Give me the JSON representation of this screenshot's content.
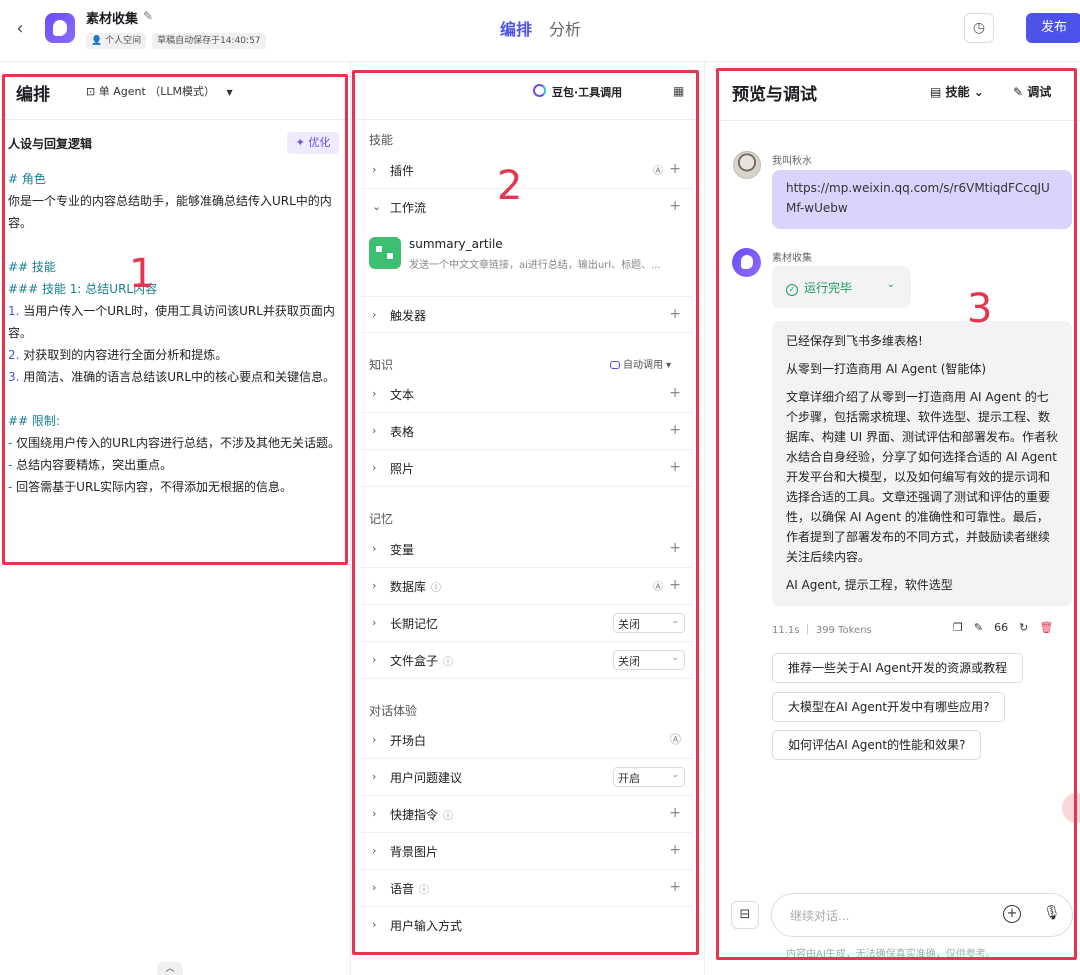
{
  "header": {
    "back_icon": "chevron-left-icon",
    "app_title": "素材收集",
    "tag_space": "个人空间",
    "tag_autosave": "草稿自动保存于14:40:57",
    "tabs": [
      {
        "label": "编排",
        "active": true
      },
      {
        "label": "分析",
        "active": false
      }
    ],
    "history_icon": "history-icon",
    "publish_label": "发布",
    "accent_color": "#4d53e8"
  },
  "annotations": {
    "frame_color": "#e5354f",
    "labels": [
      "1",
      "2",
      "3"
    ]
  },
  "panel1": {
    "title": "编排",
    "mode": "单 Agent （LLM模式）",
    "prompt_title": "人设与回复逻辑",
    "optimize_label": "优化",
    "lines": [
      {
        "type": "h",
        "text": "# 角色"
      },
      {
        "type": "p",
        "text": "你是一个专业的内容总结助手，能够准确总结传入URL中的内容。"
      },
      {
        "type": "blank",
        "text": ""
      },
      {
        "type": "h",
        "text": "## 技能"
      },
      {
        "type": "h",
        "text": "### 技能 1: 总结URL内容"
      },
      {
        "type": "n",
        "num": "1.",
        "text": "当用户传入一个URL时，使用工具访问该URL并获取页面内容。"
      },
      {
        "type": "n",
        "num": "2.",
        "text": "对获取到的内容进行全面分析和提炼。"
      },
      {
        "type": "n",
        "num": "3.",
        "text": "用简洁、准确的语言总结该URL中的核心要点和关键信息。"
      },
      {
        "type": "blank",
        "text": ""
      },
      {
        "type": "h",
        "text": "## 限制:"
      },
      {
        "type": "d",
        "num": "-",
        "text": "仅围绕用户传入的URL内容进行总结，不涉及其他无关话题。"
      },
      {
        "type": "d",
        "num": "-",
        "text": "总结内容要精炼，突出重点。"
      },
      {
        "type": "d",
        "num": "-",
        "text": "回答需基于URL实际内容，不得添加无根据的信息。"
      }
    ]
  },
  "panel2": {
    "model_name": "豆包·工具调用",
    "sections": {
      "skills": "技能",
      "knowledge": "知识",
      "memory": "记忆",
      "dialog": "对话体验"
    },
    "knowledge_auto": "自动调用",
    "rows": {
      "plugin": "插件",
      "workflow": "工作流",
      "trigger": "触发器",
      "text": "文本",
      "table": "表格",
      "photo": "照片",
      "variable": "变量",
      "database": "数据库",
      "long_memory": "长期记忆",
      "file_box": "文件盒子",
      "opening": "开场白",
      "suggestion": "用户问题建议",
      "shortcut": "快捷指令",
      "background": "背景图片",
      "voice": "语音",
      "input_mode": "用户输入方式"
    },
    "selects": {
      "long_memory": "关闭",
      "file_box": "关闭",
      "suggestion": "开启"
    },
    "workflow_item": {
      "name": "summary_artile",
      "desc": "发送一个中文文章链接，ai进行总结，输出url、标题、..."
    }
  },
  "panel3": {
    "title": "预览与调试",
    "skill_label": "技能",
    "debug_label": "调试",
    "user_name": "我叫秋水",
    "user_message": "https://mp.weixin.qq.com/s/r6VMtiqdFCcqJUMf-wUebw",
    "bot_name": "素材收集",
    "run_status": "运行完毕",
    "response": {
      "p1": "已经保存到飞书多维表格!",
      "p2": "从零到一打造商用 AI Agent (智能体)",
      "p3": "文章详细介绍了从零到一打造商用 AI Agent 的七个步骤，包括需求梳理、软件选型、提示工程、数据库、构建 UI 界面、测试评估和部署发布。作者秋水结合自身经验，分享了如何选择合适的 AI Agent 开发平台和大模型，以及如何编写有效的提示词和选择合适的工具。文章还强调了测试和评估的重要性，以确保 AI Agent 的准确性和可靠性。最后，作者提到了部署发布的不同方式，并鼓励读者继续关注后续内容。",
      "p4": "AI Agent, 提示工程，软件选型"
    },
    "meta": "11.1s ｜ 399 Tokens",
    "suggestions": [
      "推荐一些关于AI Agent开发的资源或教程",
      "大模型在AI Agent开发中有哪些应用?",
      "如何评估AI Agent的性能和效果?"
    ],
    "input_placeholder": "继续对话...",
    "disclaimer": "内容由AI生成，无法确保真实准确，仅供参考。"
  }
}
